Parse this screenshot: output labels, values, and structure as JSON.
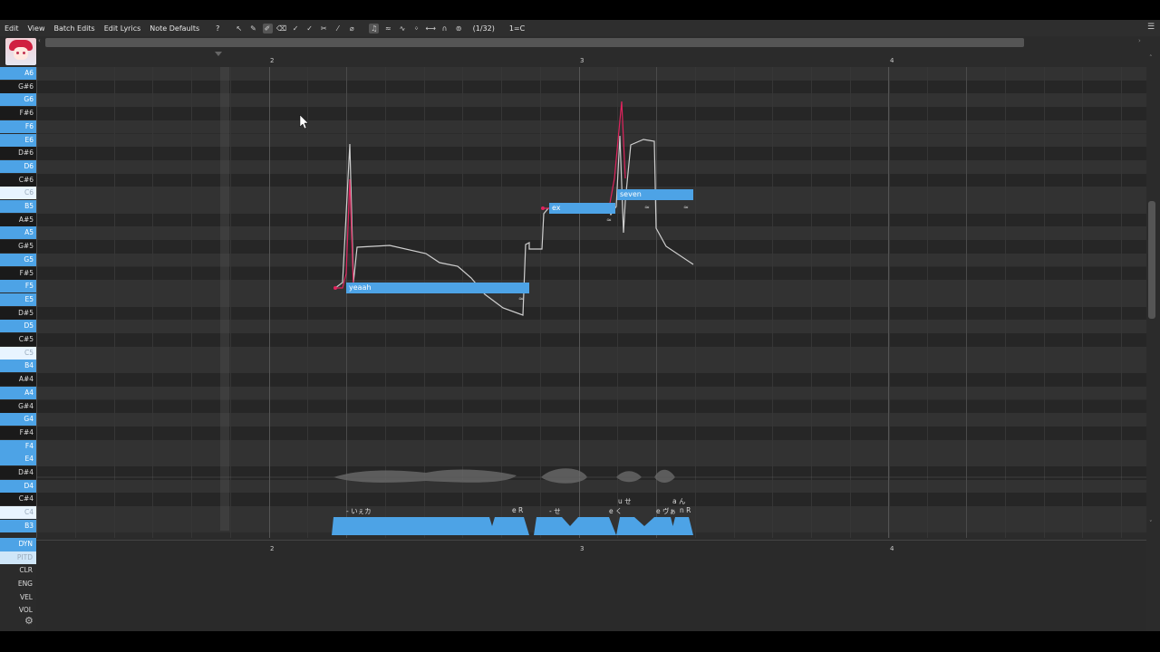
{
  "menu": {
    "items": [
      "Edit",
      "View",
      "Batch Edits",
      "Edit Lyrics",
      "Note Defaults",
      "?"
    ],
    "snap": "(1/32)",
    "key": "1=C"
  },
  "ruler": {
    "marks": [
      "2",
      "3",
      "4"
    ]
  },
  "piano_keys": [
    {
      "label": "A6",
      "type": "white"
    },
    {
      "label": "G#6",
      "type": "black"
    },
    {
      "label": "G6",
      "type": "white"
    },
    {
      "label": "F#6",
      "type": "black"
    },
    {
      "label": "F6",
      "type": "white"
    },
    {
      "label": "E6",
      "type": "white"
    },
    {
      "label": "D#6",
      "type": "black"
    },
    {
      "label": "D6",
      "type": "white"
    },
    {
      "label": "C#6",
      "type": "black"
    },
    {
      "label": "C6",
      "type": "light"
    },
    {
      "label": "B5",
      "type": "white"
    },
    {
      "label": "A#5",
      "type": "black"
    },
    {
      "label": "A5",
      "type": "white"
    },
    {
      "label": "G#5",
      "type": "black"
    },
    {
      "label": "G5",
      "type": "white"
    },
    {
      "label": "F#5",
      "type": "black"
    },
    {
      "label": "F5",
      "type": "white"
    },
    {
      "label": "E5",
      "type": "white"
    },
    {
      "label": "D#5",
      "type": "black"
    },
    {
      "label": "D5",
      "type": "white"
    },
    {
      "label": "C#5",
      "type": "black"
    },
    {
      "label": "C5",
      "type": "light"
    },
    {
      "label": "B4",
      "type": "white"
    },
    {
      "label": "A#4",
      "type": "black"
    },
    {
      "label": "A4",
      "type": "white"
    },
    {
      "label": "G#4",
      "type": "black"
    },
    {
      "label": "G4",
      "type": "white"
    },
    {
      "label": "F#4",
      "type": "black"
    },
    {
      "label": "F4",
      "type": "white"
    },
    {
      "label": "E4",
      "type": "white"
    },
    {
      "label": "D#4",
      "type": "black"
    },
    {
      "label": "D4",
      "type": "white"
    },
    {
      "label": "C#4",
      "type": "black"
    },
    {
      "label": "C4",
      "type": "light"
    },
    {
      "label": "B3",
      "type": "white"
    }
  ],
  "notes": [
    {
      "lyric": "yeaah"
    },
    {
      "lyric": "ex"
    },
    {
      "lyric": "seven"
    }
  ],
  "phonemes": [
    "- いぇカ",
    "e R",
    "- せ",
    "u せ",
    "e く",
    "a ん",
    "e ヴぁ",
    "n R"
  ],
  "expressions": [
    {
      "label": "DYN",
      "state": "active"
    },
    {
      "label": "PITD",
      "state": "sel"
    },
    {
      "label": "CLR",
      "state": "normal"
    },
    {
      "label": "ENG",
      "state": "normal"
    },
    {
      "label": "VEL",
      "state": "normal"
    },
    {
      "label": "VOL",
      "state": "normal"
    }
  ],
  "colors": {
    "accent": "#4da3e6",
    "pitch_curve": "#e0245e"
  }
}
